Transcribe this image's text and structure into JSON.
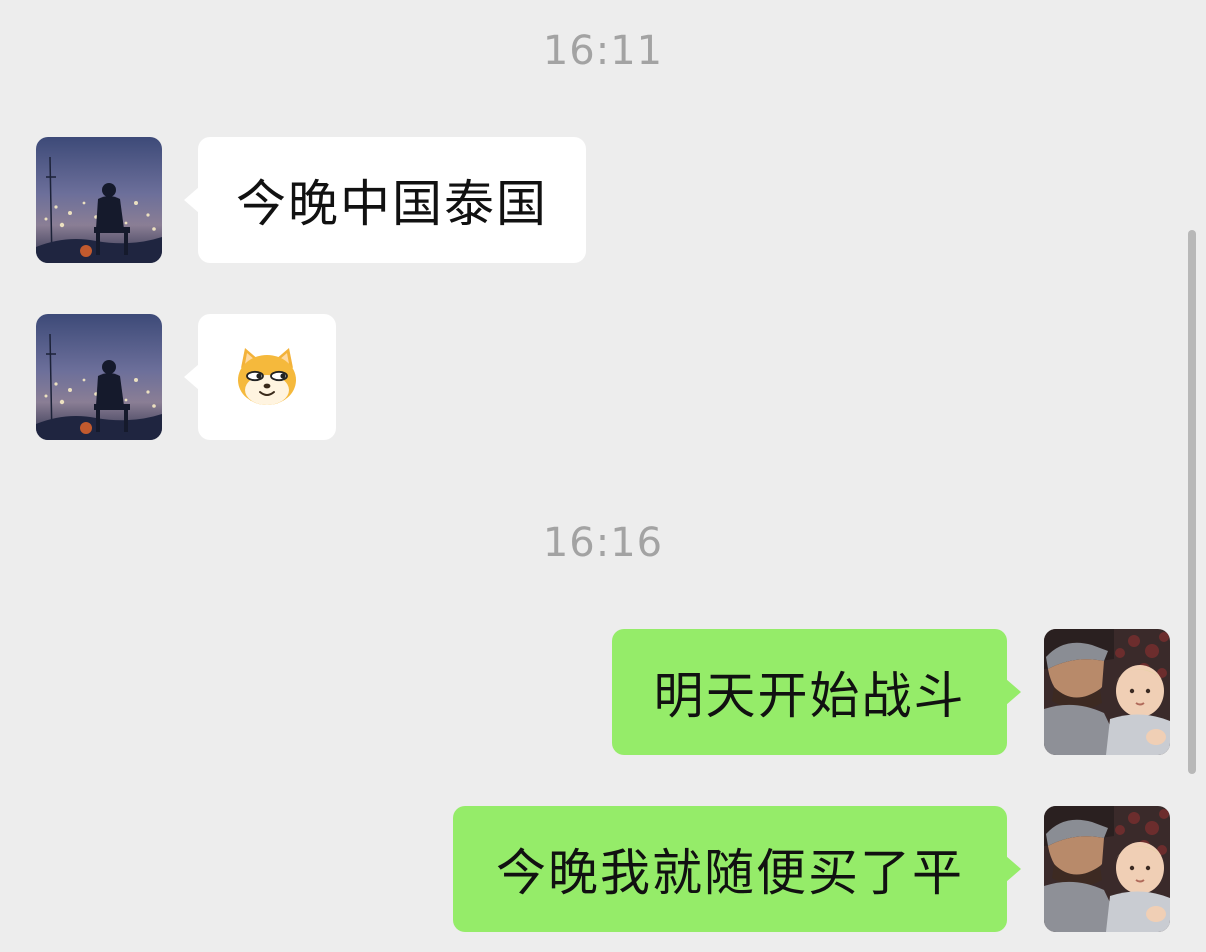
{
  "chat": {
    "timestamps": [
      "16:11",
      "16:16"
    ],
    "messages": [
      {
        "side": "incoming",
        "type": "text",
        "text": "今晚中国泰国"
      },
      {
        "side": "incoming",
        "type": "sticker",
        "sticker": "doge-emoji-icon"
      },
      {
        "side": "outgoing",
        "type": "text",
        "text": "明天开始战斗"
      },
      {
        "side": "outgoing",
        "type": "text",
        "text": "今晚我就随便买了平"
      }
    ]
  },
  "colors": {
    "background": "#ededed",
    "incoming_bubble": "#ffffff",
    "outgoing_bubble": "#95ec69",
    "timestamp_text": "#a3a3a3",
    "message_text": "#111111"
  },
  "icons": {
    "contact_avatar": "night-city-silhouette-avatar",
    "my_avatar": "man-with-baby-avatar",
    "sticker": "doge-emoji-icon"
  }
}
